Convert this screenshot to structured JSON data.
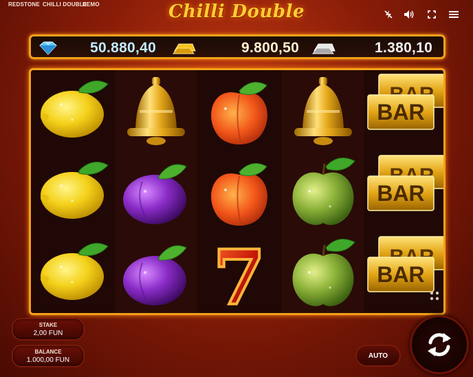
{
  "header": {
    "nav": [
      "REDSTONE",
      "CHILLI DOUBLE",
      "DEMO"
    ],
    "title": "Chilli Double"
  },
  "controls": {
    "icons": [
      "turbo-off-icon",
      "sound-icon",
      "fullscreen-icon",
      "menu-icon"
    ]
  },
  "jackpots": [
    {
      "icon": "diamond-icon",
      "value": "50.880,40",
      "color": "#bfe9ff"
    },
    {
      "icon": "gold-bar-icon",
      "value": "9.800,50",
      "color": "#fff3d0"
    },
    {
      "icon": "silver-bar-icon",
      "value": "1.380,10",
      "color": "#f2f2f2"
    }
  ],
  "reels": [
    [
      "lemon",
      "lemon",
      "lemon"
    ],
    [
      "bell",
      "plum",
      "plum"
    ],
    [
      "peach",
      "peach",
      "seven"
    ],
    [
      "bell",
      "apple",
      "apple"
    ],
    [
      "bar",
      "bar",
      "bar"
    ]
  ],
  "symbol_text": {
    "bar": "BAR",
    "seven": "7"
  },
  "stake": {
    "label": "STAKE",
    "value": "2,00 FUN"
  },
  "balance": {
    "label": "BALANCE",
    "value": "1.000,00 FUN"
  },
  "auto_label": "AUTO",
  "colors": {
    "accent": "#f3a11a",
    "title": "#ffcc33"
  }
}
